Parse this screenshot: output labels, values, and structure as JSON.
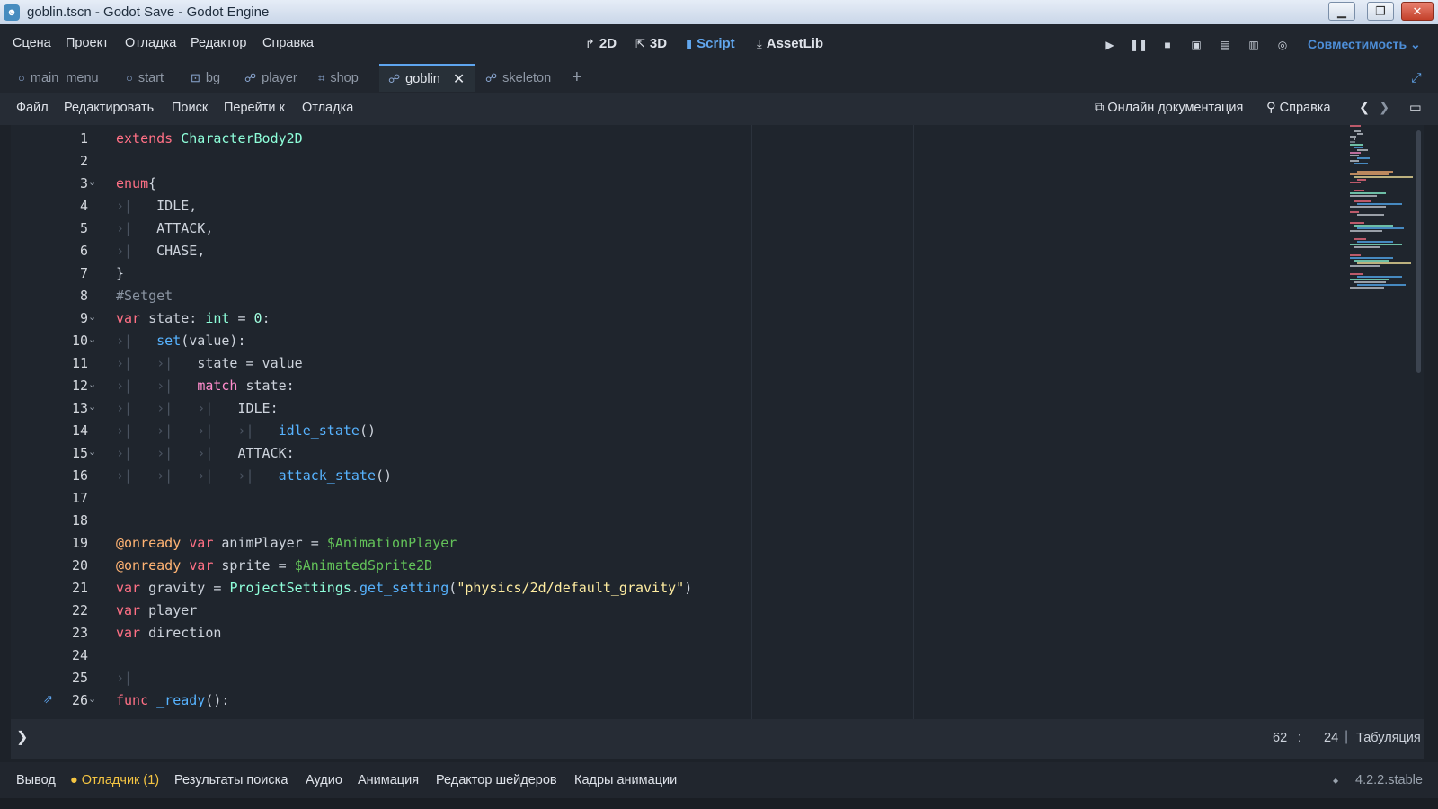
{
  "window": {
    "title": "goblin.tscn - Godot Save - Godot Engine"
  },
  "menu": {
    "items": [
      "Сцена",
      "Проект",
      "Отладка",
      "Редактор",
      "Справка"
    ]
  },
  "modes": [
    {
      "label": "2D",
      "icon": "2d-icon"
    },
    {
      "label": "3D",
      "icon": "3d-icon"
    },
    {
      "label": "Script",
      "icon": "script-icon"
    },
    {
      "label": "AssetLib",
      "icon": "assetlib-icon"
    }
  ],
  "renderer": "Совместимость",
  "scene_tabs": [
    {
      "label": "main_menu",
      "icon": "node-circle-icon"
    },
    {
      "label": "start",
      "icon": "node-circle-icon"
    },
    {
      "label": "bg",
      "icon": "node2d-icon"
    },
    {
      "label": "player",
      "icon": "character-body-icon"
    },
    {
      "label": "shop",
      "icon": "control-icon"
    },
    {
      "label": "goblin",
      "icon": "character-body-icon",
      "active": true
    },
    {
      "label": "skeleton",
      "icon": "character-body-icon"
    }
  ],
  "script_menu": [
    "Файл",
    "Редактировать",
    "Поиск",
    "Перейти к",
    "Отладка"
  ],
  "online_docs": "Онлайн документация",
  "help": "Справка",
  "code_lines": [
    {
      "n": "1"
    },
    {
      "n": "2"
    },
    {
      "n": "3"
    },
    {
      "n": "4"
    },
    {
      "n": "5"
    },
    {
      "n": "6"
    },
    {
      "n": "7"
    },
    {
      "n": "8"
    },
    {
      "n": "9"
    },
    {
      "n": "10"
    },
    {
      "n": "11"
    },
    {
      "n": "12"
    },
    {
      "n": "13"
    },
    {
      "n": "14"
    },
    {
      "n": "15"
    },
    {
      "n": "16"
    },
    {
      "n": "17"
    },
    {
      "n": "18"
    },
    {
      "n": "19"
    },
    {
      "n": "20"
    },
    {
      "n": "21"
    },
    {
      "n": "22"
    },
    {
      "n": "23"
    },
    {
      "n": "24"
    },
    {
      "n": "25"
    },
    {
      "n": "26"
    }
  ],
  "code": {
    "l1a": "extends",
    "l1b": "CharacterBody2D",
    "l3a": "enum",
    "l3b": "{",
    "l4": "IDLE,",
    "l5": "ATTACK,",
    "l6": "CHASE,",
    "l7": "}",
    "l8": "#Setget",
    "l9a": "var",
    "l9b": "state:",
    "l9c": "int",
    "l9d": "=",
    "l9e": "0",
    "l9f": ":",
    "l10a": "set",
    "l10b": "(value):",
    "l11": "state = value",
    "l12a": "match",
    "l12b": "state:",
    "l13": "IDLE:",
    "l14a": "idle_state",
    "l14b": "()",
    "l15": "ATTACK:",
    "l16a": "attack_state",
    "l16b": "()",
    "l19a": "@onready",
    "l19b": "var",
    "l19c": "animPlayer =",
    "l19d": "$AnimationPlayer",
    "l20a": "@onready",
    "l20b": "var",
    "l20c": "sprite =",
    "l20d": "$AnimatedSprite2D",
    "l21a": "var",
    "l21b": "gravity =",
    "l21c": "ProjectSettings",
    "l21d": ".",
    "l21e": "get_setting",
    "l21f": "(",
    "l21g": "\"physics/2d/default_gravity\"",
    "l21h": ")",
    "l22a": "var",
    "l22b": "player",
    "l23a": "var",
    "l23b": "direction",
    "l26a": "func",
    "l26b": "_ready",
    "l26c": "():"
  },
  "status": {
    "line": "62",
    "sep": ":",
    "col": "24",
    "indent": "Табуляция"
  },
  "dock": {
    "items": [
      "Вывод",
      "Отладчик (1)",
      "Результаты поиска",
      "Аудио",
      "Анимация",
      "Редактор шейдеров",
      "Кадры анимации"
    ],
    "version": "4.2.2.stable"
  },
  "colors": {
    "accent": "#5ea5ef",
    "keyword": "#ff7085",
    "function": "#57b3ff",
    "string": "#ffeda1"
  }
}
